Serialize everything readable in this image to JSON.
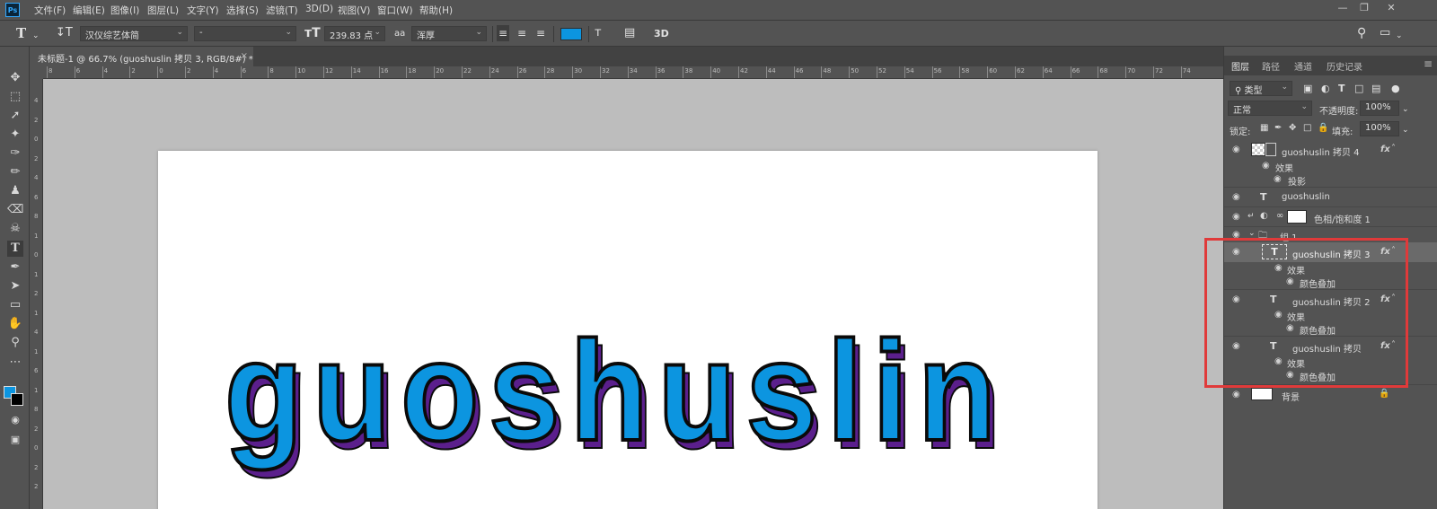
{
  "menubar": {
    "logo": "Ps",
    "items": [
      "文件(F)",
      "编辑(E)",
      "图像(I)",
      "图层(L)",
      "文字(Y)",
      "选择(S)",
      "滤镜(T)",
      "3D(D)",
      "视图(V)",
      "窗口(W)",
      "帮助(H)"
    ]
  },
  "options": {
    "font_family": "汉仪综艺体简",
    "font_style": "-",
    "font_size": "239.83 点",
    "antialias_icon": "aa",
    "antialias": "浑厚",
    "text_color": "#0c95e0",
    "threed": "3D"
  },
  "document": {
    "tab_title": "未标题-1 @ 66.7% (guoshuslin 拷贝 3, RGB/8#) *",
    "close": "×",
    "canvas_text": "guoshuslin",
    "text_fill": "#0c95e0",
    "text_stroke": "#0a0a0a",
    "text_shadow": "#5b1f8c"
  },
  "ruler": {
    "h_ticks": [
      "8",
      "6",
      "4",
      "2",
      "0",
      "2",
      "4",
      "6",
      "8",
      "10",
      "12",
      "14",
      "16",
      "18",
      "20",
      "22",
      "24",
      "26",
      "28",
      "30",
      "32",
      "34",
      "36",
      "38",
      "40",
      "42",
      "44",
      "46",
      "48",
      "50",
      "52",
      "54",
      "56",
      "58",
      "60",
      "62",
      "64",
      "66",
      "68",
      "70",
      "72",
      "74"
    ],
    "v_ticks": [
      "4",
      "2",
      "0",
      "2",
      "4",
      "6",
      "8",
      "1",
      "0",
      "1",
      "2",
      "1",
      "4",
      "1",
      "6",
      "1",
      "8",
      "2",
      "0",
      "2",
      "2"
    ]
  },
  "panel": {
    "tabs": [
      "图层",
      "路径",
      "通道",
      "历史记录"
    ],
    "filter_label": "类型",
    "blend_mode": "正常",
    "opacity_label": "不透明度:",
    "opacity_value": "100%",
    "lock_label": "锁定:",
    "fill_label": "填充:",
    "fill_value": "100%",
    "layers": {
      "copy4": "guoshuslin 拷贝 4",
      "copy4_effects": "效果",
      "copy4_effect1": "投影",
      "orig": "guoshuslin",
      "huesat": "色相/饱和度 1",
      "group": "组 1",
      "copy3": "guoshuslin 拷贝 3",
      "copy3_effects": "效果",
      "copy3_effect1": "颜色叠加",
      "copy2": "guoshuslin 拷贝 2",
      "copy2_effects": "效果",
      "copy2_effect1": "颜色叠加",
      "copy1": "guoshuslin 拷贝",
      "copy1_effects": "效果",
      "copy1_effect1": "颜色叠加",
      "background": "背景"
    },
    "fx_label": "fx"
  },
  "colors": {
    "highlight": "#e03a3a",
    "foreground": "#0c95e0",
    "background": "#000000"
  }
}
